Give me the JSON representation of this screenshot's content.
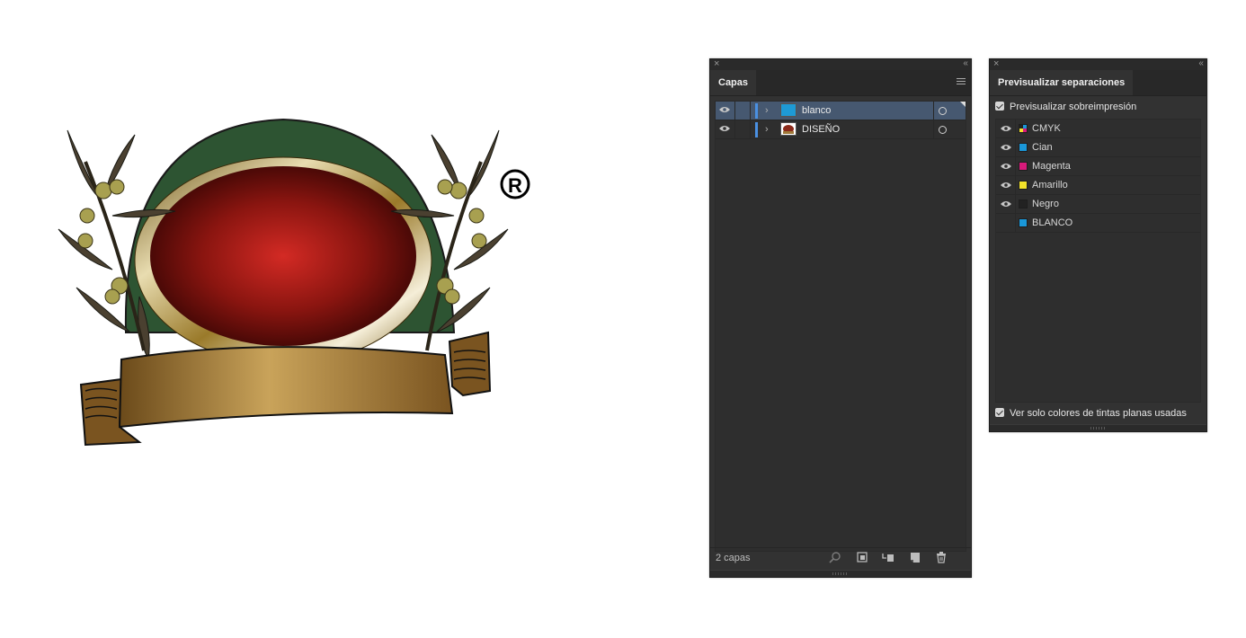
{
  "artwork": {
    "registered_mark": "®"
  },
  "layers_panel": {
    "tab": "Capas",
    "layers": [
      {
        "name": "blanco",
        "selected": true,
        "visible": true,
        "thumb_color": "#1e9ad6"
      },
      {
        "name": "DISEÑO",
        "selected": false,
        "visible": true,
        "thumb_color": "#8b2a1a"
      }
    ],
    "footer_count": "2 capas",
    "footer_icons": [
      "search-icon",
      "clipping-mask-icon",
      "sublayer-icon",
      "new-layer-icon",
      "trash-icon"
    ]
  },
  "separations_panel": {
    "tab": "Previsualizar separaciones",
    "overprint_label": "Previsualizar sobreimpresión",
    "overprint_checked": true,
    "separations": [
      {
        "name": "CMYK",
        "visible": true,
        "color": "cmyk"
      },
      {
        "name": "Cian",
        "visible": true,
        "color": "#1a97d8"
      },
      {
        "name": "Magenta",
        "visible": true,
        "color": "#d81a7a"
      },
      {
        "name": "Amarillo",
        "visible": true,
        "color": "#f2e22a"
      },
      {
        "name": "Negro",
        "visible": true,
        "color": "#222222"
      },
      {
        "name": "BLANCO",
        "visible": false,
        "color": "#1a97d8"
      }
    ],
    "spot_only_label": "Ver solo colores de tintas planas usadas",
    "spot_only_checked": true
  }
}
